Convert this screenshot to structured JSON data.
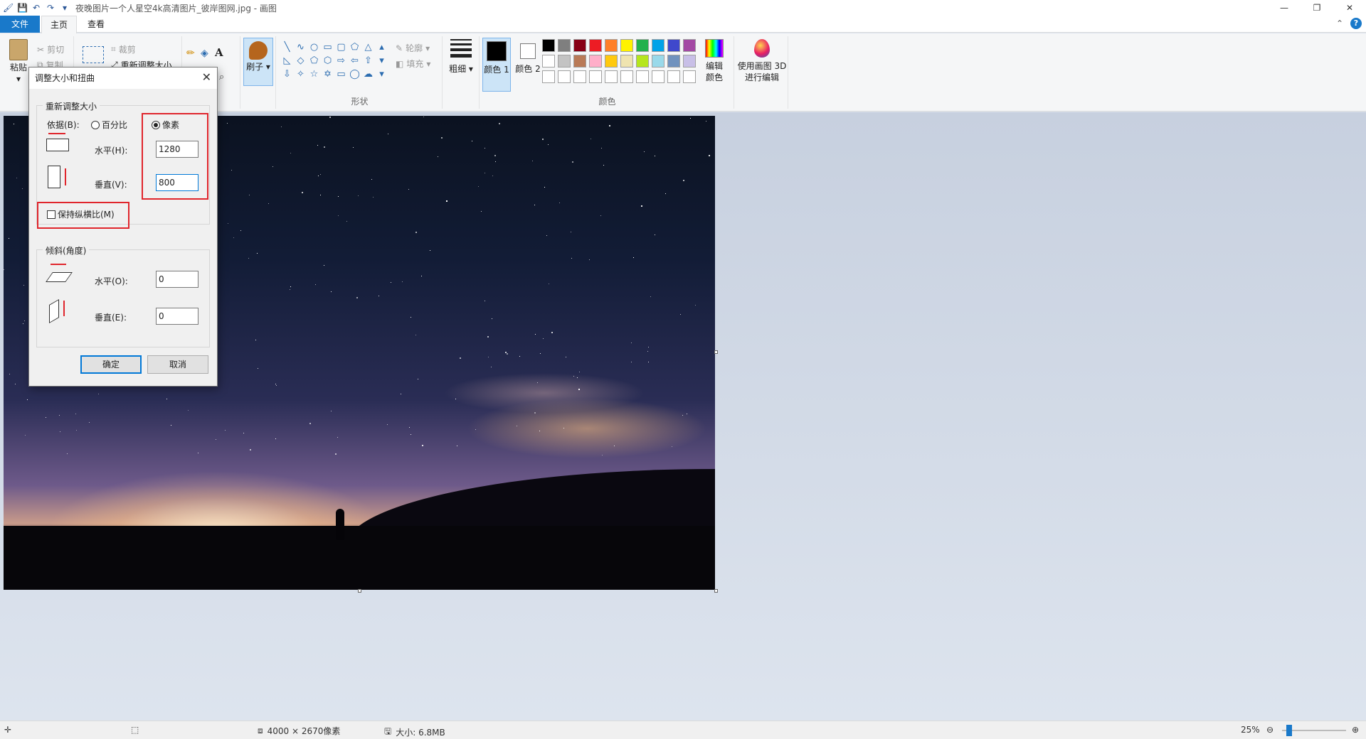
{
  "window": {
    "title": "夜晚图片一个人星空4k高清图片_彼岸图网.jpg - 画图"
  },
  "tabs": {
    "file": "文件",
    "home": "主页",
    "view": "查看"
  },
  "ribbon": {
    "paste": "粘贴",
    "cut": "剪切",
    "copy": "复制",
    "crop": "裁剪",
    "resize": "重新调整大小",
    "brush": "刷子",
    "outline": "轮廓",
    "fill": "填充",
    "shapes_label": "形状",
    "size": "粗细",
    "color1": "颜色 1",
    "color2": "颜色 2",
    "colors_label": "颜色",
    "edit_colors": "编辑颜色",
    "paint3d": "使用画图 3D 进行编辑",
    "palette": [
      "#000000",
      "#7f7f7f",
      "#880015",
      "#ed1c24",
      "#ff7f27",
      "#fff200",
      "#22b14c",
      "#00a2e8",
      "#3f48cc",
      "#a349a4",
      "#ffffff",
      "#c3c3c3",
      "#b97a57",
      "#ffaec9",
      "#ffc90e",
      "#efe4b0",
      "#b5e61d",
      "#99d9ea",
      "#7092be",
      "#c8bfe7",
      "#ffffff",
      "#ffffff",
      "#ffffff",
      "#ffffff",
      "#ffffff",
      "#ffffff",
      "#ffffff",
      "#ffffff",
      "#ffffff",
      "#ffffff"
    ]
  },
  "dialog": {
    "title": "调整大小和扭曲",
    "resize_group": "重新调整大小",
    "by_label": "依据(B):",
    "percent": "百分比",
    "pixels": "像素",
    "horizontal_label": "水平(H):",
    "horizontal_value": "1280",
    "vertical_label": "垂直(V):",
    "vertical_value": "800",
    "keep_ratio": "保持纵横比(M)",
    "skew_group": "倾斜(角度)",
    "skew_h_label": "水平(O):",
    "skew_h_value": "0",
    "skew_v_label": "垂直(E):",
    "skew_v_value": "0",
    "ok": "确定",
    "cancel": "取消"
  },
  "statusbar": {
    "dimensions": "4000 × 2670像素",
    "size": "大小: 6.8MB",
    "zoom": "25%"
  }
}
